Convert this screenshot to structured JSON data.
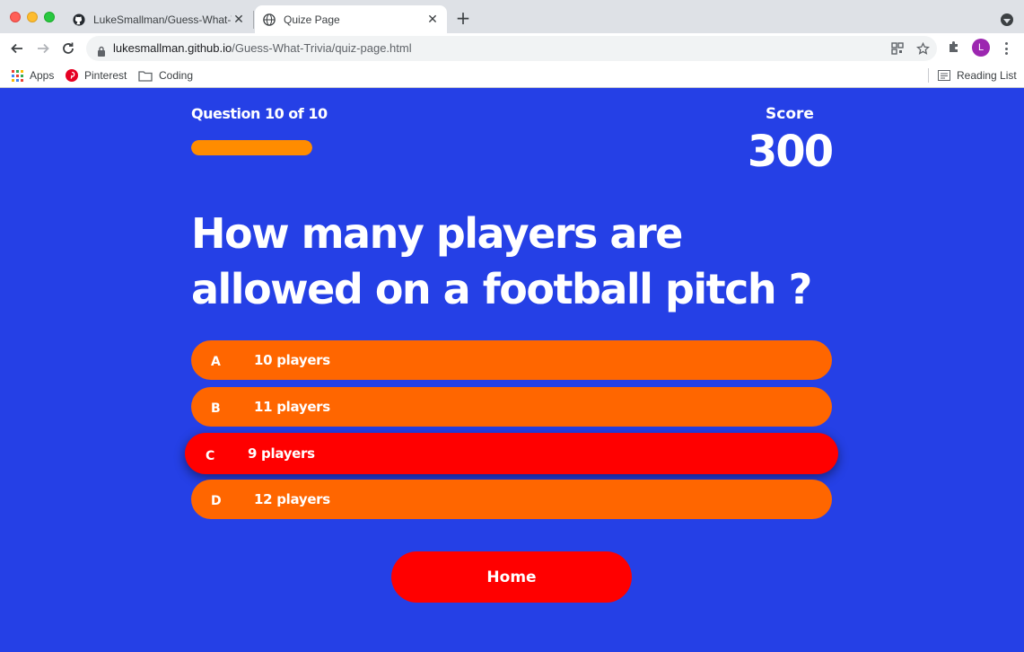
{
  "browser": {
    "tabs": [
      {
        "title": "LukeSmallman/Guess-What-Trivia",
        "icon": "github-icon",
        "active": false
      },
      {
        "title": "Quize Page",
        "icon": "globe-icon",
        "active": true
      }
    ],
    "url_host": "lukesmallman.github.io",
    "url_path": "/Guess-What-Trivia/quiz-page.html",
    "profile_initial": "L",
    "bookmarks": [
      {
        "label": "Apps",
        "icon": "apps-grid-icon"
      },
      {
        "label": "Pinterest",
        "icon": "pinterest-icon"
      },
      {
        "label": "Coding",
        "icon": "folder-icon"
      }
    ],
    "reading_list": "Reading List"
  },
  "quiz": {
    "progress_text": "Question 10 of 10",
    "progress_fraction": 1.0,
    "score_label": "Score",
    "score_value": "300",
    "question": "How many players are allowed on a football pitch ?",
    "choices": [
      {
        "prefix": "A",
        "text": "10 players",
        "state": "default"
      },
      {
        "prefix": "B",
        "text": "11 players",
        "state": "default"
      },
      {
        "prefix": "C",
        "text": "9 players",
        "state": "incorrect"
      },
      {
        "prefix": "D",
        "text": "12 players",
        "state": "default"
      }
    ],
    "home_label": "Home"
  },
  "colors": {
    "page_background": "#2540e6",
    "choice_default": "#ff6600",
    "choice_incorrect": "#ff0000",
    "progress_fill": "#ff8c00",
    "home_button": "#ff0000"
  }
}
